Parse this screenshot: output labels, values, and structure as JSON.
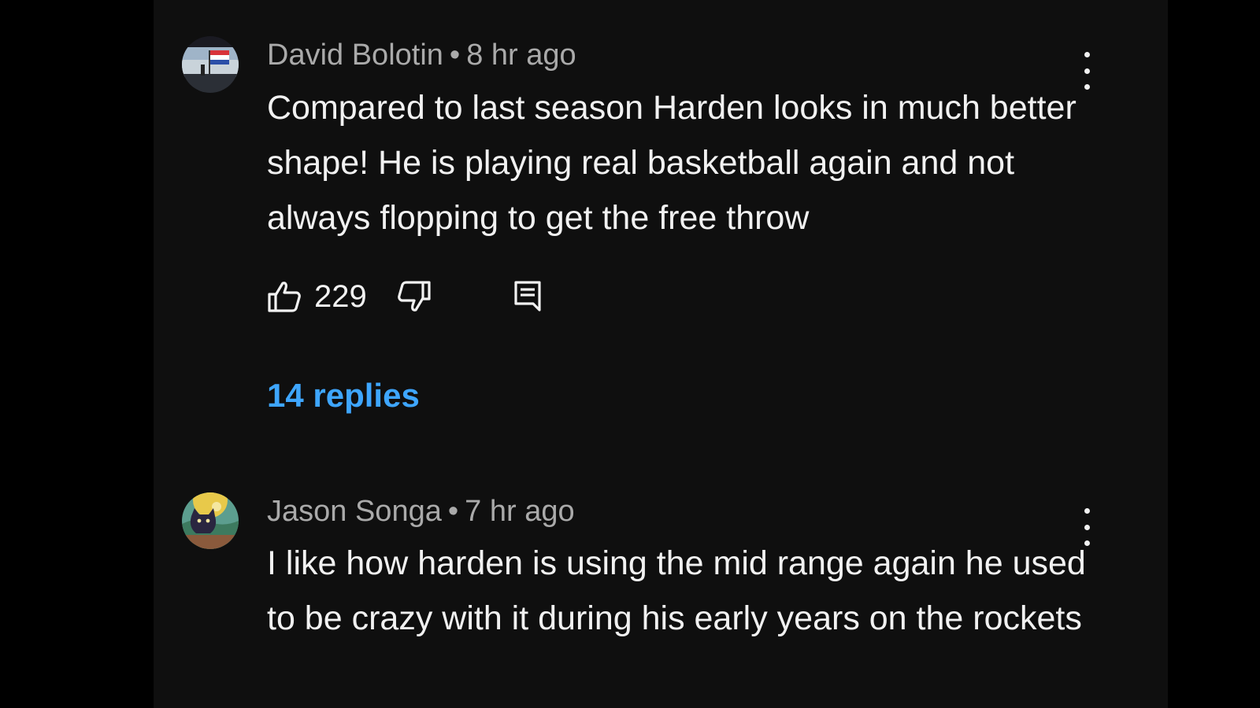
{
  "comments": [
    {
      "author": "David Bolotin",
      "separator": "•",
      "time": "8 hr ago",
      "text": "Compared to last season Harden looks in much better shape! He is playing real basketball again and not always flopping to get the free throw",
      "likes": "229",
      "replies": "14 replies",
      "avatar_icon": "flag-avatar-icon"
    },
    {
      "author": "Jason Songa",
      "separator": "•",
      "time": "7 hr ago",
      "text": "I like how harden is using the mid range again he used to be crazy with it during his early years on the rockets",
      "avatar_icon": "cat-avatar-icon"
    }
  ],
  "colors": {
    "background": "#0f0f0f",
    "text": "#f1f1f1",
    "meta": "#aaaaaa",
    "link": "#3ea6ff"
  }
}
